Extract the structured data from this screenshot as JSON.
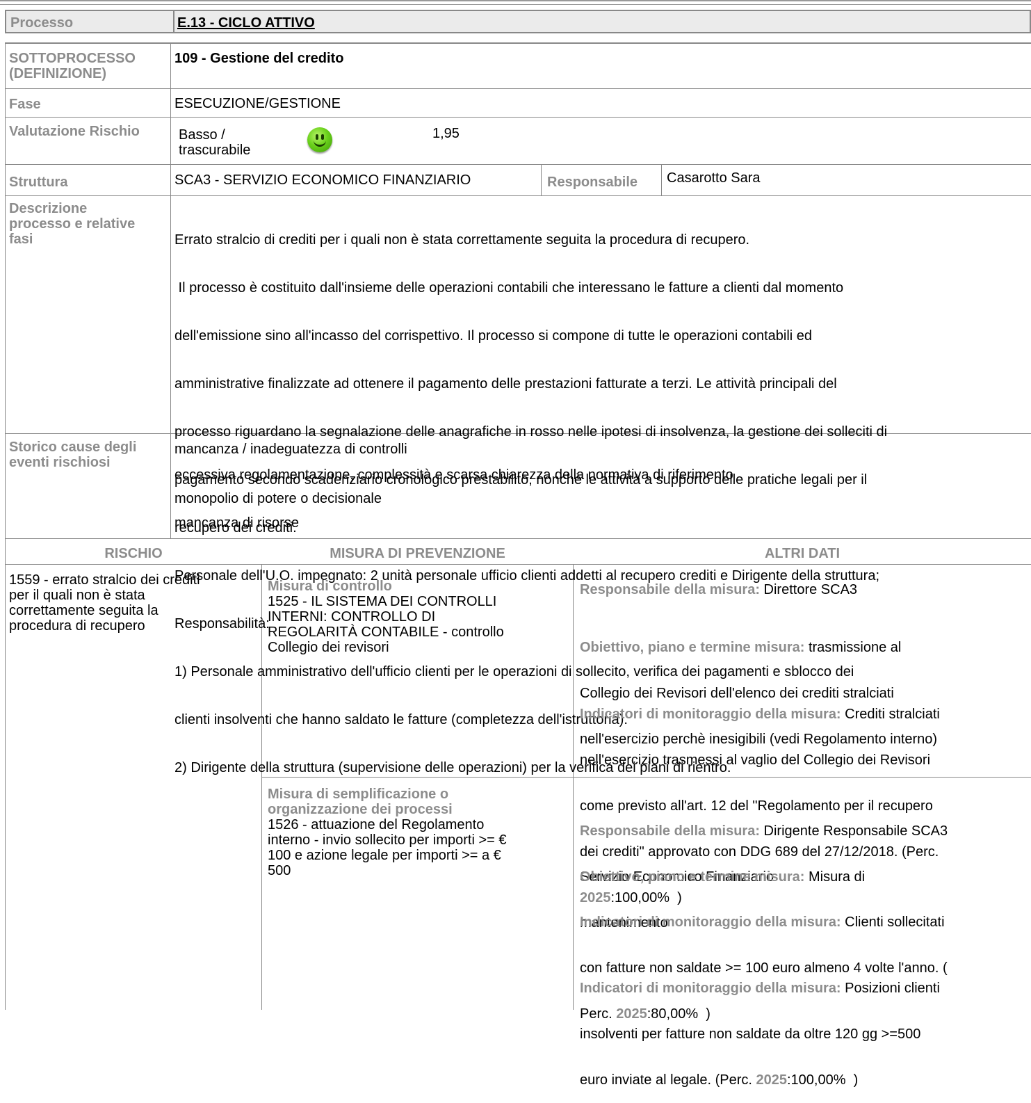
{
  "processo": {
    "label": "Processo",
    "value": "E.13 - CICLO ATTIVO"
  },
  "sottoprocesso": {
    "label_line1": "SOTTOPROCESSO",
    "label_line2": "(DEFINIZIONE)",
    "value": "109 - Gestione del credito"
  },
  "fase": {
    "label": "Fase",
    "value": "ESECUZIONE/GESTIONE"
  },
  "valutazione": {
    "label": "Valutazione Rischio",
    "level_line1": "Basso /",
    "level_line2": "trascurabile",
    "icon": "smiley-green-icon",
    "score": "1,95"
  },
  "struttura": {
    "label": "Struttura",
    "value": "SCA3 - SERVIZIO ECONOMICO FINANZIARIO",
    "resp_label": "Responsabile",
    "resp_value": "Casarotto Sara"
  },
  "descrizione": {
    "label_lines": [
      "Descrizione",
      "processo e relative",
      "fasi"
    ],
    "lines": [
      "Errato stralcio di crediti per i quali non è stata correttamente seguita la procedura di recupero.",
      " Il processo è costituito dall'insieme delle operazioni contabili che interessano le fatture a clienti dal momento",
      "dell'emissione sino all'incasso del corrispettivo. Il processo si compone di tutte le operazioni contabili ed",
      "amministrative finalizzate ad ottenere il pagamento delle prestazioni fatturate a terzi. Le attività principali del",
      "processo riguardano la segnalazione delle anagrafiche in rosso nelle ipotesi di insolvenza, la gestione dei solleciti di",
      "pagamento secondo scadenziario cronologico prestabilito, nonchè le attività a supporto delle pratiche legali per il",
      "recupero dei crediti.",
      "Personale dell'U.O. impegnato: 2 unità personale ufficio clienti addetti al recupero crediti e Dirigente della struttura;",
      "Responsabilità:",
      "1) Personale amministrativo dell'ufficio clienti per le operazioni di sollecito, verifica dei pagamenti e sblocco dei",
      "clienti insolventi che hanno saldato le fatture (completezza dell'istruttoria).",
      "2) Dirigente della struttura (supervisione delle operazioni) per la verifica dei piani di rientro."
    ]
  },
  "storico": {
    "label_lines": [
      "Storico cause degli",
      "eventi rischiosi"
    ],
    "items": [
      "mancanza / inadeguatezza di controlli",
      "eccessiva regolamentazione, complessità e scarsa chiarezza della normativa di riferimento",
      "monopolio di potere o decisionale",
      "mancanza di risorse"
    ]
  },
  "table_headers": {
    "rischio": "RISCHIO",
    "misura": "MISURA DI PREVENZIONE",
    "altri": "ALTRI DATI"
  },
  "rischio": {
    "lines": [
      "1559 - errato stralcio dei crediti",
      "per il quali non è stata",
      "correttamente seguita la",
      "procedura di recupero"
    ]
  },
  "misure": [
    {
      "type": "Misura di controllo",
      "desc_lines": [
        "1525 - IL SISTEMA DEI CONTROLLI",
        "INTERNI: CONTROLLO DI",
        "REGOLARITÀ CONTABILE - controllo",
        "Collegio dei revisori"
      ],
      "resp_label": "Responsabile della misura:",
      "resp_value": " Direttore SCA3",
      "obj_label": "Obiettivo, piano e termine misura:",
      "obj_lines": [
        " trasmissione al",
        "Collegio dei Revisori dell'elenco dei crediti stralciati",
        "nell'esercizio perchè inesigibili (vedi Regolamento interno)"
      ],
      "ind_label": "Indicatori di monitoraggio della misura:",
      "ind_lines": [
        " Crediti stralciati",
        "nell'esercizio trasmessi al vaglio del Collegio dei Revisori",
        "come previsto all'art. 12 del \"Regolamento per il recupero",
        "dei crediti\" approvato con DDG 689 del 27/12/2018. (Perc."
      ],
      "ind_year": "2025",
      "ind_perc": ":100,00%  )"
    },
    {
      "type_lines": [
        "Misura di semplificazione o",
        "organizzazione dei processi"
      ],
      "desc_lines": [
        "1526 - attuazione del Regolamento",
        "interno  - invio sollecito per importi >= €",
        "100 e azione legale per importi >= a €",
        "500"
      ],
      "resp_label": "Responsabile della misura:",
      "resp_lines": [
        " Dirigente Responsabile SCA3",
        "Servizio Economico Finanziario"
      ],
      "obj_label": "Obiettivo, piano e termine misura:",
      "obj_lines": [
        " Misura di",
        "mantenimento"
      ],
      "ind1_label": "Indicatori di monitoraggio della misura:",
      "ind1_lines": [
        " Clienti sollecitati",
        "con fatture non saldate >= 100 euro almeno 4 volte l'anno. (",
        "Perc. "
      ],
      "ind1_year": "2025",
      "ind1_perc": ":80,00%  )",
      "ind2_label": "Indicatori di monitoraggio della misura:",
      "ind2_lines": [
        " Posizioni clienti",
        "insolventi per fatture non saldate da oltre 120 gg >=500",
        "euro inviate al legale. (Perc. "
      ],
      "ind2_year": "2025",
      "ind2_perc": ":100,00%  )"
    }
  ]
}
